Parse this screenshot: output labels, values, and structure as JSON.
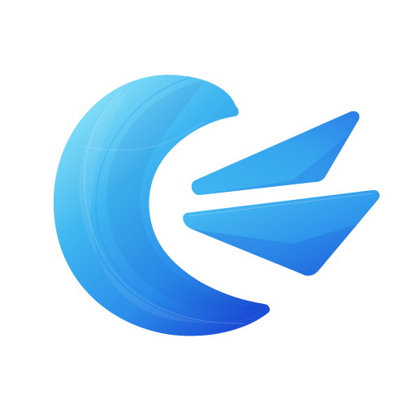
{
  "icon": {
    "name": "app-logo-icon",
    "colors": {
      "background": "#ffffff",
      "light_cyan": "#8EE4F8",
      "sky_blue": "#3FB6F0",
      "mid_blue": "#2A8EEA",
      "deep_blue": "#1B4FD6",
      "accent_line": "#1E73DE"
    }
  }
}
